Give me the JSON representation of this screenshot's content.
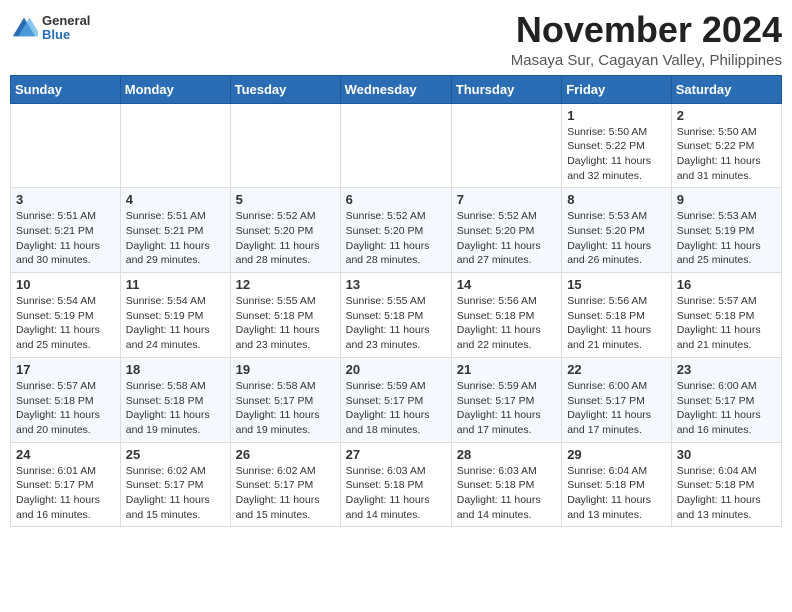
{
  "header": {
    "logo": {
      "general": "General",
      "blue": "Blue"
    },
    "title": "November 2024",
    "subtitle": "Masaya Sur, Cagayan Valley, Philippines"
  },
  "weekdays": [
    "Sunday",
    "Monday",
    "Tuesday",
    "Wednesday",
    "Thursday",
    "Friday",
    "Saturday"
  ],
  "weeks": [
    [
      {
        "day": "",
        "info": ""
      },
      {
        "day": "",
        "info": ""
      },
      {
        "day": "",
        "info": ""
      },
      {
        "day": "",
        "info": ""
      },
      {
        "day": "",
        "info": ""
      },
      {
        "day": "1",
        "info": "Sunrise: 5:50 AM\nSunset: 5:22 PM\nDaylight: 11 hours\nand 32 minutes."
      },
      {
        "day": "2",
        "info": "Sunrise: 5:50 AM\nSunset: 5:22 PM\nDaylight: 11 hours\nand 31 minutes."
      }
    ],
    [
      {
        "day": "3",
        "info": "Sunrise: 5:51 AM\nSunset: 5:21 PM\nDaylight: 11 hours\nand 30 minutes."
      },
      {
        "day": "4",
        "info": "Sunrise: 5:51 AM\nSunset: 5:21 PM\nDaylight: 11 hours\nand 29 minutes."
      },
      {
        "day": "5",
        "info": "Sunrise: 5:52 AM\nSunset: 5:20 PM\nDaylight: 11 hours\nand 28 minutes."
      },
      {
        "day": "6",
        "info": "Sunrise: 5:52 AM\nSunset: 5:20 PM\nDaylight: 11 hours\nand 28 minutes."
      },
      {
        "day": "7",
        "info": "Sunrise: 5:52 AM\nSunset: 5:20 PM\nDaylight: 11 hours\nand 27 minutes."
      },
      {
        "day": "8",
        "info": "Sunrise: 5:53 AM\nSunset: 5:20 PM\nDaylight: 11 hours\nand 26 minutes."
      },
      {
        "day": "9",
        "info": "Sunrise: 5:53 AM\nSunset: 5:19 PM\nDaylight: 11 hours\nand 25 minutes."
      }
    ],
    [
      {
        "day": "10",
        "info": "Sunrise: 5:54 AM\nSunset: 5:19 PM\nDaylight: 11 hours\nand 25 minutes."
      },
      {
        "day": "11",
        "info": "Sunrise: 5:54 AM\nSunset: 5:19 PM\nDaylight: 11 hours\nand 24 minutes."
      },
      {
        "day": "12",
        "info": "Sunrise: 5:55 AM\nSunset: 5:18 PM\nDaylight: 11 hours\nand 23 minutes."
      },
      {
        "day": "13",
        "info": "Sunrise: 5:55 AM\nSunset: 5:18 PM\nDaylight: 11 hours\nand 23 minutes."
      },
      {
        "day": "14",
        "info": "Sunrise: 5:56 AM\nSunset: 5:18 PM\nDaylight: 11 hours\nand 22 minutes."
      },
      {
        "day": "15",
        "info": "Sunrise: 5:56 AM\nSunset: 5:18 PM\nDaylight: 11 hours\nand 21 minutes."
      },
      {
        "day": "16",
        "info": "Sunrise: 5:57 AM\nSunset: 5:18 PM\nDaylight: 11 hours\nand 21 minutes."
      }
    ],
    [
      {
        "day": "17",
        "info": "Sunrise: 5:57 AM\nSunset: 5:18 PM\nDaylight: 11 hours\nand 20 minutes."
      },
      {
        "day": "18",
        "info": "Sunrise: 5:58 AM\nSunset: 5:18 PM\nDaylight: 11 hours\nand 19 minutes."
      },
      {
        "day": "19",
        "info": "Sunrise: 5:58 AM\nSunset: 5:17 PM\nDaylight: 11 hours\nand 19 minutes."
      },
      {
        "day": "20",
        "info": "Sunrise: 5:59 AM\nSunset: 5:17 PM\nDaylight: 11 hours\nand 18 minutes."
      },
      {
        "day": "21",
        "info": "Sunrise: 5:59 AM\nSunset: 5:17 PM\nDaylight: 11 hours\nand 17 minutes."
      },
      {
        "day": "22",
        "info": "Sunrise: 6:00 AM\nSunset: 5:17 PM\nDaylight: 11 hours\nand 17 minutes."
      },
      {
        "day": "23",
        "info": "Sunrise: 6:00 AM\nSunset: 5:17 PM\nDaylight: 11 hours\nand 16 minutes."
      }
    ],
    [
      {
        "day": "24",
        "info": "Sunrise: 6:01 AM\nSunset: 5:17 PM\nDaylight: 11 hours\nand 16 minutes."
      },
      {
        "day": "25",
        "info": "Sunrise: 6:02 AM\nSunset: 5:17 PM\nDaylight: 11 hours\nand 15 minutes."
      },
      {
        "day": "26",
        "info": "Sunrise: 6:02 AM\nSunset: 5:17 PM\nDaylight: 11 hours\nand 15 minutes."
      },
      {
        "day": "27",
        "info": "Sunrise: 6:03 AM\nSunset: 5:18 PM\nDaylight: 11 hours\nand 14 minutes."
      },
      {
        "day": "28",
        "info": "Sunrise: 6:03 AM\nSunset: 5:18 PM\nDaylight: 11 hours\nand 14 minutes."
      },
      {
        "day": "29",
        "info": "Sunrise: 6:04 AM\nSunset: 5:18 PM\nDaylight: 11 hours\nand 13 minutes."
      },
      {
        "day": "30",
        "info": "Sunrise: 6:04 AM\nSunset: 5:18 PM\nDaylight: 11 hours\nand 13 minutes."
      }
    ]
  ]
}
